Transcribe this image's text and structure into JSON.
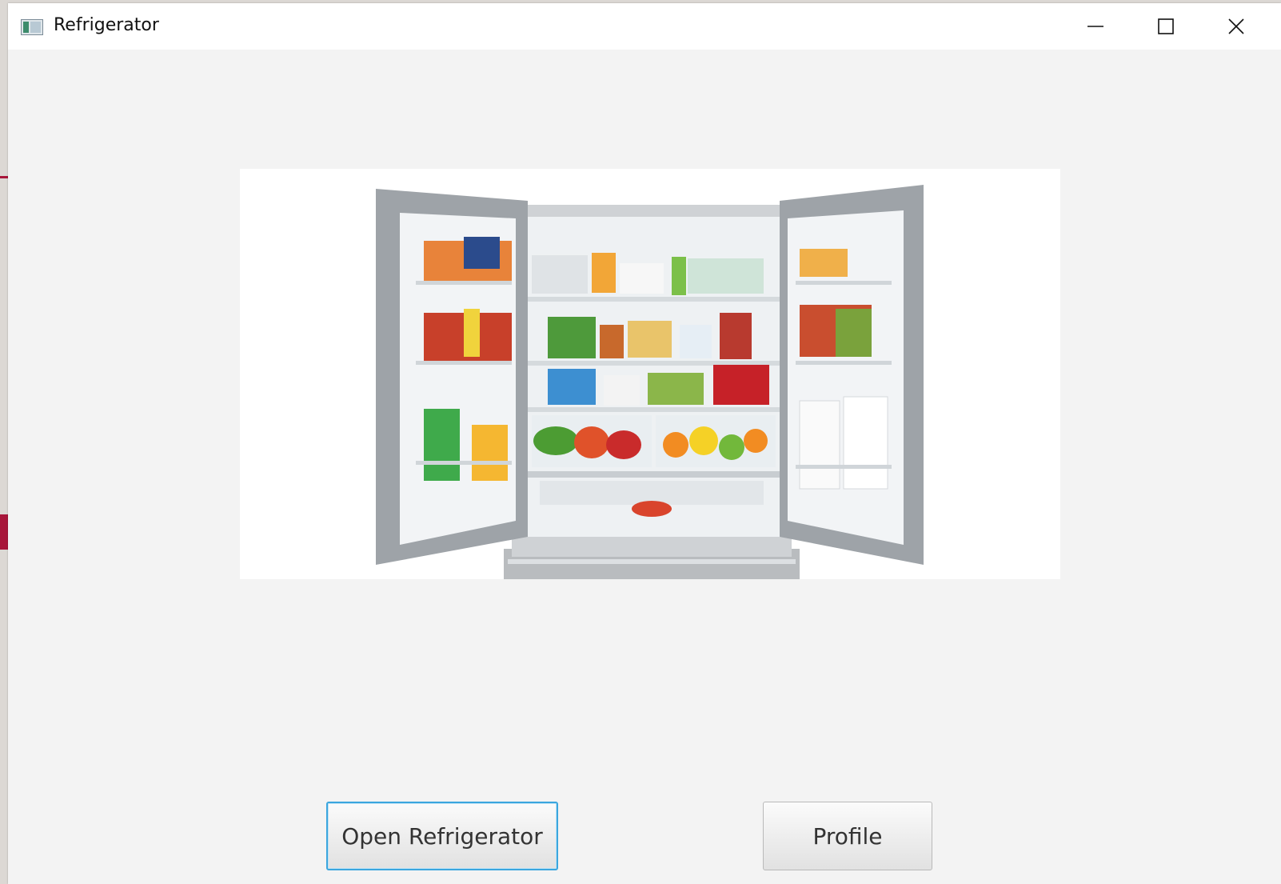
{
  "window": {
    "title": "Refrigerator",
    "controls": {
      "minimize": "minimize-icon",
      "maximize": "maximize-icon",
      "close": "close-icon"
    }
  },
  "main": {
    "image": "refrigerator-open-photo",
    "buttons": {
      "open_label": "Open Refrigerator",
      "profile_label": "Profile"
    }
  },
  "colors": {
    "accent": "#a8163a",
    "focus_border": "#3ba6de",
    "window_bg": "#f3f3f3"
  }
}
